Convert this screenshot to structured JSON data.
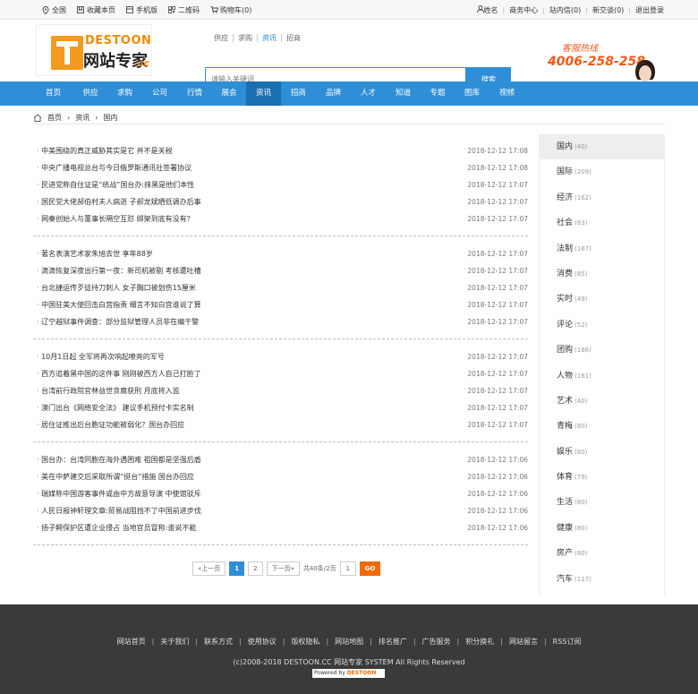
{
  "topbar": {
    "left": [
      {
        "icon": "location-icon",
        "label": "全国"
      },
      {
        "icon": "bookmark-icon",
        "label": "收藏本页"
      },
      {
        "icon": "mobile-icon",
        "label": "手机版"
      },
      {
        "icon": "qrcode-icon",
        "label": "二维码"
      },
      {
        "icon": "cart-icon",
        "label": "购物车(0)"
      }
    ],
    "right": [
      "姓名",
      "商务中心",
      "站内信(0)",
      "新交谈(0)",
      "退出登录"
    ]
  },
  "logo": {
    "brand": "DESTOON",
    "name": "网站专家",
    "suffix": "cc"
  },
  "search": {
    "tabs": [
      "供应",
      "求购",
      "资讯",
      "招商"
    ],
    "active_tab": "资讯",
    "placeholder": "请输入关键词",
    "button": "搜索"
  },
  "hotline": {
    "label": "客服热线",
    "number": "4006-258-258"
  },
  "nav": {
    "items": [
      "首页",
      "供应",
      "求购",
      "公司",
      "行情",
      "展会",
      "资讯",
      "招商",
      "品牌",
      "人才",
      "知道",
      "专题",
      "图库",
      "视频"
    ],
    "active": "资讯"
  },
  "breadcrumb": [
    "首页",
    "资讯",
    "国内"
  ],
  "news_groups": [
    [
      {
        "title": "中美围绕的真正威胁其实是它 并不是关税",
        "date": "2018-12-12 17:08"
      },
      {
        "title": "中央广播电视总台与今日俄罗斯通讯社签署协议",
        "date": "2018-12-12 17:08"
      },
      {
        "title": "民进党称自住证是“统战”国台办:抹黑是他们本性",
        "date": "2018-12-12 17:07"
      },
      {
        "title": "国民党大佬郝伯村夫人病逝 子郝龙斌晒低调办后事",
        "date": "2018-12-12 17:07"
      },
      {
        "title": "网秦创始人与董事长隔空互怼 绑架到底有没有？",
        "date": "2018-12-12 17:07"
      }
    ],
    [
      {
        "title": "著名表演艺术家朱旭去世 享年88岁",
        "date": "2018-12-12 17:07"
      },
      {
        "title": "滴滴恢复深夜出行第一夜：新司机被剔 考核遭吐槽",
        "date": "2018-12-12 17:07"
      },
      {
        "title": "台北捷运传歹徒持刀刺人 女子胸口被划伤15厘米",
        "date": "2018-12-12 17:07"
      },
      {
        "title": "中国驻美大使回击白宫指责 细言不知白宫谁说了算",
        "date": "2018-12-12 17:07"
      },
      {
        "title": "辽宁越狱事件调查：部分监狱管理人员非在编干警",
        "date": "2018-12-12 17:07"
      }
    ],
    [
      {
        "title": "10月1日起 全军将再次响起嘹亮的军号",
        "date": "2018-12-12 17:07"
      },
      {
        "title": "西方追着黑中国的这件事 刚刚被西方人自己打脸了",
        "date": "2018-12-12 17:07"
      },
      {
        "title": "台湾前行政院官林益世贪腐获刑 月底将入监",
        "date": "2018-12-12 17:07"
      },
      {
        "title": "澳门出台《网络安全法》 建议手机预付卡实名制",
        "date": "2018-12-12 17:07"
      },
      {
        "title": "居住证推出后台胞证功能被弱化？国台办回应",
        "date": "2018-12-12 17:07"
      }
    ],
    [
      {
        "title": "国台办：台湾同胞在海外遇困难 祖国都是坚强后盾",
        "date": "2018-12-12 17:06"
      },
      {
        "title": "美在中萨建交后采取所谓“挺台”措施 国台办回应",
        "date": "2018-12-12 17:06"
      },
      {
        "title": "瑞媒称中国游客事件或由中方故意导演 中使馆驳斥",
        "date": "2018-12-12 17:06"
      },
      {
        "title": "人民日报钟轩理文章:贸易战阻挡不了中国前进步伐",
        "date": "2018-12-12 17:06"
      },
      {
        "title": "扬子鳄保护区遭企业侵占 当地官员冒称:谁说不能",
        "date": "2018-12-12 17:06"
      }
    ]
  ],
  "pager": {
    "prev": "«上一页",
    "current": "1",
    "page2": "2",
    "next": "下一页»",
    "summary": "共40条/2页",
    "jump_value": "1",
    "go": "GO"
  },
  "sidebar": [
    {
      "name": "国内",
      "count": "(40)"
    },
    {
      "name": "国际",
      "count": "(209)"
    },
    {
      "name": "经济",
      "count": "(162)"
    },
    {
      "name": "社会",
      "count": "(83)"
    },
    {
      "name": "法制",
      "count": "(167)"
    },
    {
      "name": "消费",
      "count": "(85)"
    },
    {
      "name": "实时",
      "count": "(49)"
    },
    {
      "name": "评论",
      "count": "(52)"
    },
    {
      "name": "团购",
      "count": "(166)"
    },
    {
      "name": "人物",
      "count": "(161)"
    },
    {
      "name": "艺术",
      "count": "(40)"
    },
    {
      "name": "青梅",
      "count": "(80)"
    },
    {
      "name": "娱乐",
      "count": "(80)"
    },
    {
      "name": "体育",
      "count": "(79)"
    },
    {
      "name": "生活",
      "count": "(80)"
    },
    {
      "name": "健康",
      "count": "(80)"
    },
    {
      "name": "房产",
      "count": "(80)"
    },
    {
      "name": "汽车",
      "count": "(117)"
    }
  ],
  "footer": {
    "links": [
      "网站首页",
      "关于我们",
      "联系方式",
      "使用协议",
      "版权隐私",
      "网站地图",
      "排名推广",
      "广告服务",
      "积分换礼",
      "网站留言",
      "RSS订阅"
    ],
    "copyright": "(c)2008-2018 DESTOON.CC 网站专家 SYSTEM All Rights Reserved",
    "powered_label": "Powered by",
    "powered_brand": "DESTOON"
  },
  "colors": {
    "accent": "#2e8ed8",
    "nav_active": "#1a6fb0",
    "hotline": "#f05a1a",
    "go": "#f06a00",
    "footer_bg": "#3a3a3a"
  }
}
